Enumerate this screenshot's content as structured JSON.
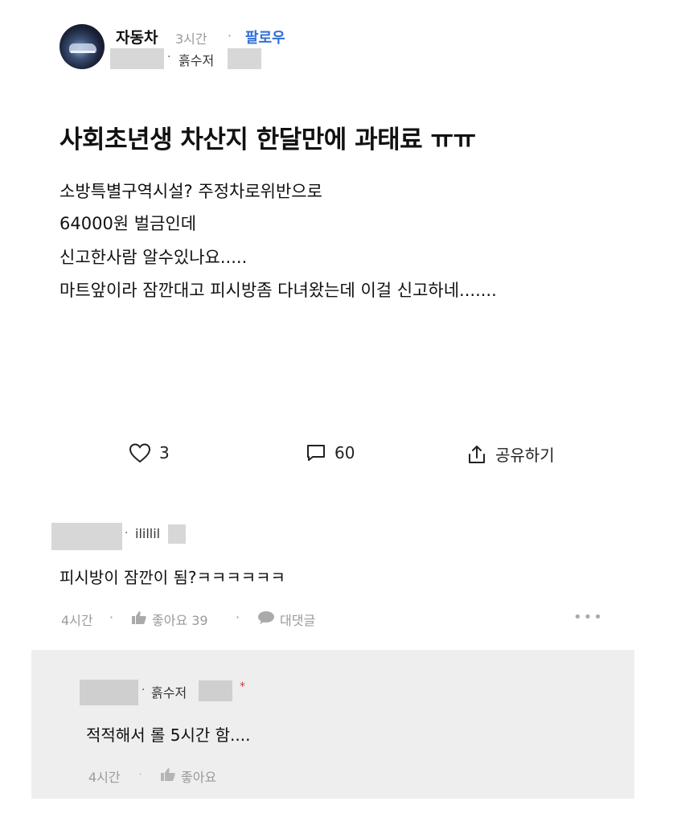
{
  "post": {
    "author": "자동차",
    "time": "3시간",
    "separator": "·",
    "follow_label": "팔로우",
    "company": "흙수저",
    "title": "사회초년생 차산지 한달만에 과태료 ㅠㅠ",
    "body": [
      "소방특별구역시설? 주정차로위반으로",
      "64000원 벌금인데",
      "신고한사람 알수있나요.....",
      "마트앞이라 잠깐대고 피시방좀 다녀왔는데 이걸 신고하네......."
    ]
  },
  "actions": {
    "like_count": "3",
    "comment_count": "60",
    "share_label": "공유하기"
  },
  "comment": {
    "company": "ilillil",
    "text": "피시방이 잠깐이 됨?ㅋㅋㅋㅋㅋㅋ",
    "time": "4시간",
    "like_label": "좋아요 39",
    "reply_label": "대댓글",
    "more": "•••"
  },
  "reply": {
    "company": "흙수저",
    "badge": "*",
    "text": "적적해서 롤 5시간 함....",
    "time": "4시간",
    "like_label": "좋아요"
  }
}
